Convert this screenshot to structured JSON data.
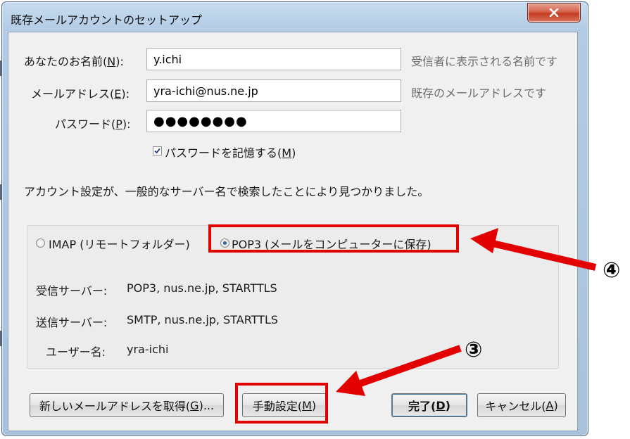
{
  "window": {
    "title": "既存メールアカウントのセットアップ",
    "close": "x"
  },
  "form": {
    "name_label": "あなたのお名前(",
    "name_key": "N",
    "name_label_end": "):",
    "name_value": "y.ichi",
    "name_hint": "受信者に表示される名前です",
    "email_label": "メールアドレス(",
    "email_key": "E",
    "email_label_end": "):",
    "email_value": "yra-ichi@nus.ne.jp",
    "email_hint": "既存のメールアドレスです",
    "password_label": "パスワード(",
    "password_key": "P",
    "password_label_end": "):",
    "password_value": "●●●●●●●●",
    "remember_label": "パスワードを記憶する(",
    "remember_key": "M",
    "remember_label_end": ")",
    "remember_checked": true
  },
  "status_message": "アカウント設定が、一般的なサーバー名で検索したことにより見つかりました。",
  "protocol": {
    "imap_label": "IMAP (リモートフォルダー)",
    "pop3_label": "POP3 (メールをコンピューターに保存)",
    "selected": "POP3"
  },
  "server_info": {
    "incoming_label": "受信サーバー:",
    "incoming_value": "POP3, nus.ne.jp, STARTTLS",
    "outgoing_label": "送信サーバー:",
    "outgoing_value": "SMTP, nus.ne.jp, STARTTLS",
    "username_label": "ユーザー名:",
    "username_value": "yra-ichi"
  },
  "buttons": {
    "new_address": "新しいメールアドレスを取得(",
    "new_address_key": "G",
    "new_address_end": ")...",
    "manual": "手動設定(",
    "manual_key": "M",
    "manual_end": ")",
    "done": "完了(",
    "done_key": "D",
    "done_end": ")",
    "cancel": "キャンセル(",
    "cancel_key": "A",
    "cancel_end": ")"
  },
  "annotations": {
    "step3": "③",
    "step4": "④",
    "highlight_color": "#e30000"
  }
}
